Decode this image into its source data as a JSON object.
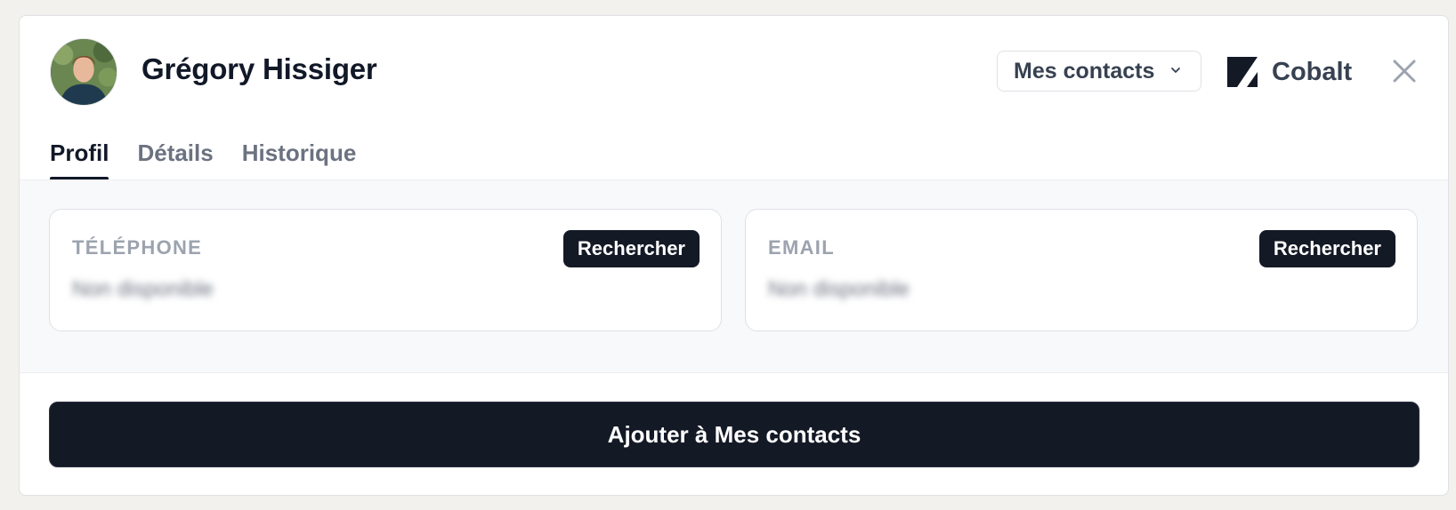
{
  "contact": {
    "name": "Grégory Hissiger"
  },
  "header": {
    "list_dropdown": {
      "selected": "Mes contacts"
    },
    "brand": {
      "name": "Cobalt"
    }
  },
  "tabs": [
    {
      "label": "Profil",
      "active": true
    },
    {
      "label": "Détails",
      "active": false
    },
    {
      "label": "Historique",
      "active": false
    }
  ],
  "fields": {
    "phone": {
      "label": "TÉLÉPHONE",
      "value": "Non disponible",
      "action": "Rechercher"
    },
    "email": {
      "label": "EMAIL",
      "value": "Non disponible",
      "action": "Rechercher"
    }
  },
  "footer": {
    "add_button": "Ajouter à Mes contacts"
  },
  "icons": [
    "avatar-photo",
    "chevron-down-icon",
    "cobalt-logo-icon",
    "close-icon"
  ],
  "colors": {
    "primary_dark": "#141926",
    "muted_text": "#9ca3af",
    "content_bg": "#f8f9fa"
  }
}
